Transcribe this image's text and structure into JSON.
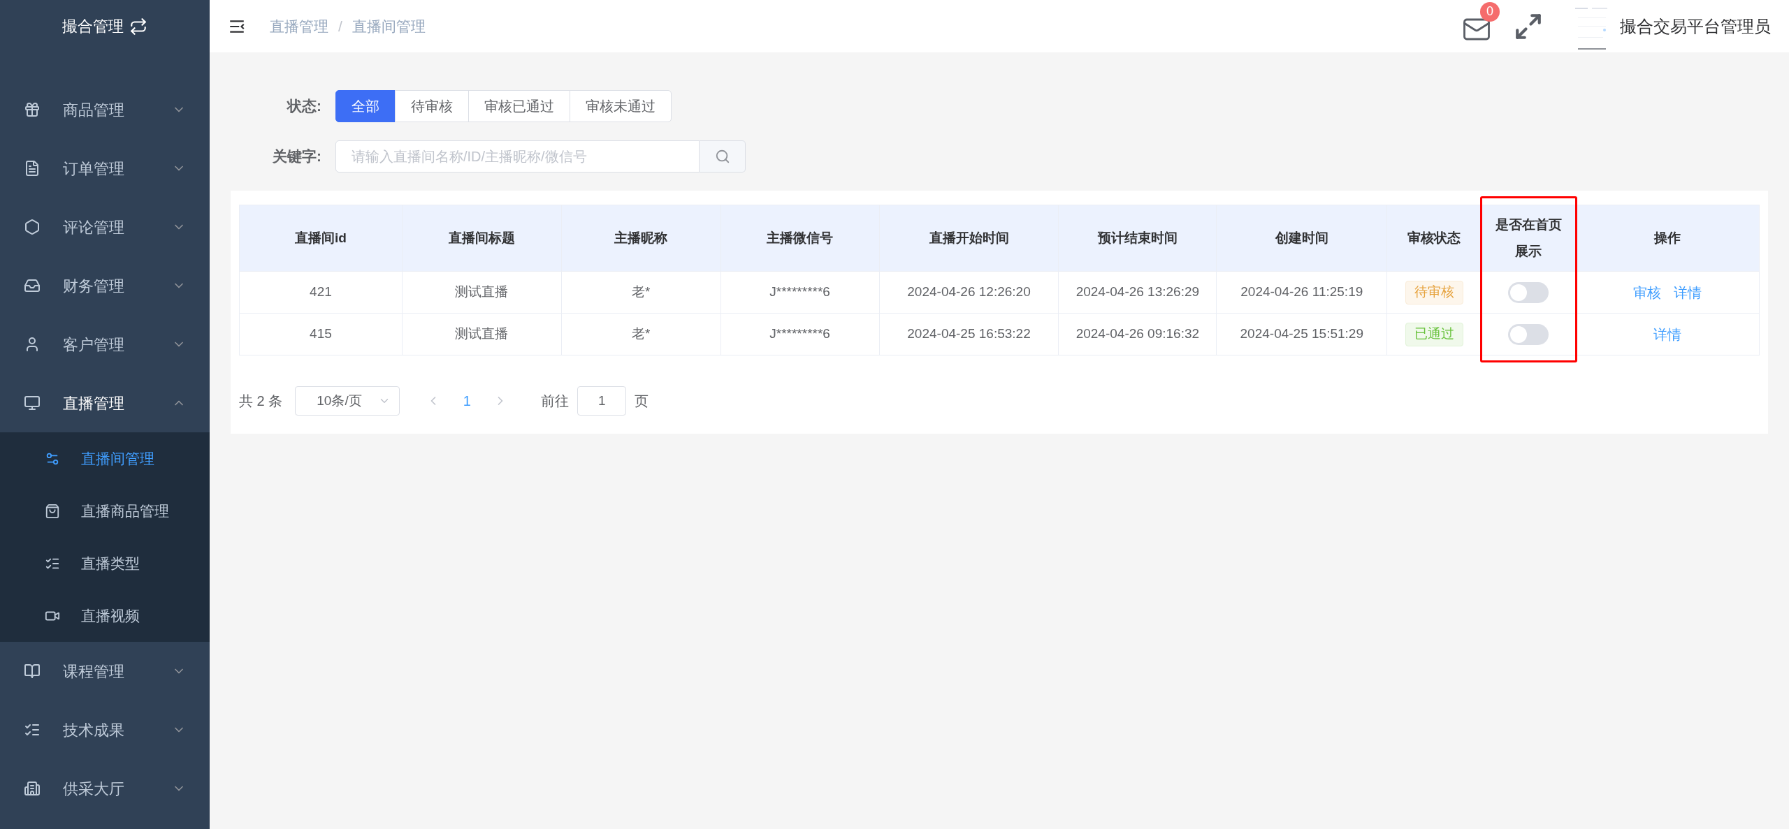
{
  "sidebar": {
    "title": "撮合管理",
    "items": [
      {
        "label": "商品管理",
        "expanded": false
      },
      {
        "label": "订单管理",
        "expanded": false
      },
      {
        "label": "评论管理",
        "expanded": false
      },
      {
        "label": "财务管理",
        "expanded": false
      },
      {
        "label": "客户管理",
        "expanded": false
      },
      {
        "label": "直播管理",
        "expanded": true,
        "children": [
          {
            "label": "直播间管理",
            "selected": true
          },
          {
            "label": "直播商品管理",
            "selected": false
          },
          {
            "label": "直播类型",
            "selected": false
          },
          {
            "label": "直播视频",
            "selected": false
          }
        ]
      },
      {
        "label": "课程管理",
        "expanded": false
      },
      {
        "label": "技术成果",
        "expanded": false
      },
      {
        "label": "供采大厅",
        "expanded": false
      }
    ]
  },
  "header": {
    "breadcrumb": [
      "直播管理",
      "直播间管理"
    ],
    "separator": "/",
    "mail_badge": "0",
    "user_name": "撮合交易平台管理员"
  },
  "filters": {
    "status_label": "状态:",
    "status_options": [
      {
        "label": "全部",
        "selected": true
      },
      {
        "label": "待审核",
        "selected": false
      },
      {
        "label": "审核已通过",
        "selected": false
      },
      {
        "label": "审核未通过",
        "selected": false
      }
    ],
    "keyword_label": "关键字:",
    "keyword_placeholder": "请输入直播间名称/ID/主播昵称/微信号"
  },
  "table": {
    "columns": [
      {
        "label": "直播间id",
        "highlighted": false
      },
      {
        "label": "直播间标题",
        "highlighted": false
      },
      {
        "label": "主播昵称",
        "highlighted": false
      },
      {
        "label": "主播微信号",
        "highlighted": false
      },
      {
        "label": "直播开始时间",
        "highlighted": false
      },
      {
        "label": "预计结束时间",
        "highlighted": false
      },
      {
        "label": "创建时间",
        "highlighted": false
      },
      {
        "label": "审核状态",
        "highlighted": false
      },
      {
        "label": "是否在首页展示",
        "highlighted": true
      },
      {
        "label": "操作",
        "highlighted": false
      }
    ],
    "rows": [
      {
        "id": "421",
        "title": "测试直播",
        "nickname": "老*",
        "wechat": "J*********6",
        "start": "2024-04-26 12:26:20",
        "end": "2024-04-26 13:26:29",
        "created": "2024-04-26 11:25:19",
        "status": {
          "text": "待审核",
          "kind": "pending"
        },
        "on_home": false,
        "actions": [
          "审核",
          "详情"
        ]
      },
      {
        "id": "415",
        "title": "测试直播",
        "nickname": "老*",
        "wechat": "J*********6",
        "start": "2024-04-25 16:53:22",
        "end": "2024-04-26 09:16:32",
        "created": "2024-04-25 15:51:29",
        "status": {
          "text": "已通过",
          "kind": "approved"
        },
        "on_home": false,
        "actions": [
          "详情"
        ]
      }
    ]
  },
  "pagination": {
    "total": "共 2 条",
    "page_size": "10条/页",
    "pages": [
      {
        "label": "1",
        "selected": true
      }
    ],
    "goto_label": "前往",
    "goto_value": "1",
    "goto_suffix": "页"
  }
}
